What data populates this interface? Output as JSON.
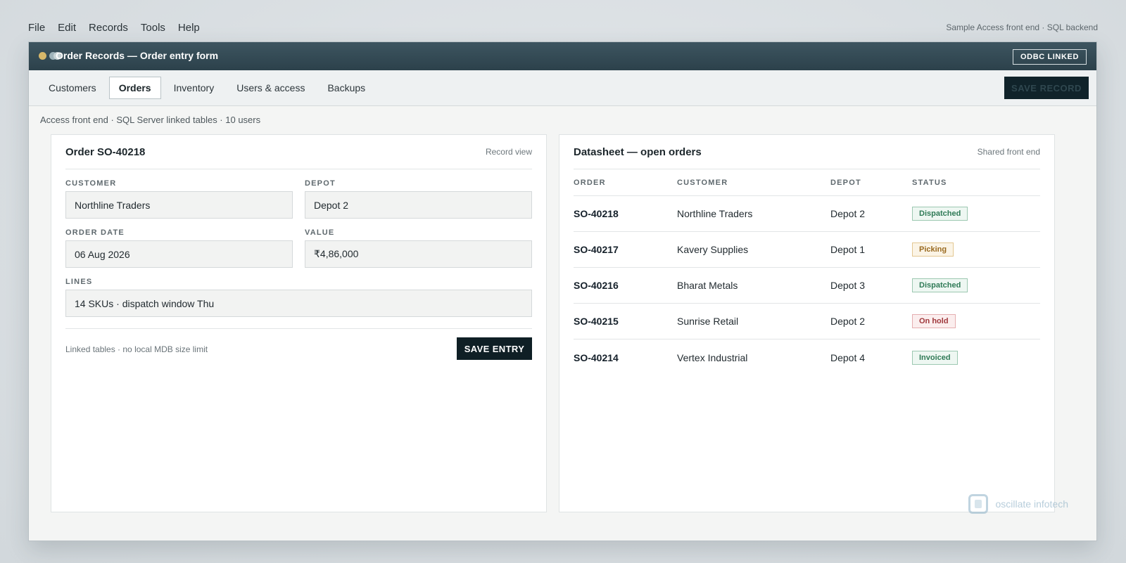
{
  "menu": {
    "items": [
      "File",
      "Edit",
      "Records",
      "Tools",
      "Help"
    ],
    "right_note": "Sample Access front end · SQL backend"
  },
  "window": {
    "title": "Order Records — Order entry form",
    "badge": "ODBC LINKED"
  },
  "tabs": [
    {
      "label": "Customers",
      "active": false
    },
    {
      "label": "Orders",
      "active": true
    },
    {
      "label": "Inventory",
      "active": false
    },
    {
      "label": "Users & access",
      "active": false
    },
    {
      "label": "Backups",
      "active": false
    }
  ],
  "toolbar": {
    "save_record_label": "SAVE RECORD"
  },
  "status_line": "Access front end · SQL Server linked tables · 10 users",
  "form": {
    "title": "Order SO-40218",
    "note": "Record view",
    "customer_label": "CUSTOMER",
    "customer_value": "Northline Traders",
    "depot_label": "DEPOT",
    "depot_value": "Depot 2",
    "order_date_label": "ORDER DATE",
    "order_date_value": "06 Aug 2026",
    "value_label": "VALUE",
    "value_value": "₹4,86,000",
    "lines_label": "LINES",
    "lines_value": "14 SKUs · dispatch window Thu",
    "footnote": "Linked tables · no local MDB size limit",
    "save_entry_label": "SAVE ENTRY"
  },
  "datasheet": {
    "title": "Datasheet — open orders",
    "note": "Shared front end",
    "columns": [
      "ORDER",
      "CUSTOMER",
      "DEPOT",
      "STATUS"
    ],
    "rows": [
      {
        "order": "SO-40218",
        "customer": "Northline Traders",
        "depot": "Depot 2",
        "status": "Dispatched",
        "status_type": "dispatched"
      },
      {
        "order": "SO-40217",
        "customer": "Kavery Supplies",
        "depot": "Depot 1",
        "status": "Picking",
        "status_type": "picking"
      },
      {
        "order": "SO-40216",
        "customer": "Bharat Metals",
        "depot": "Depot 3",
        "status": "Dispatched",
        "status_type": "dispatched"
      },
      {
        "order": "SO-40215",
        "customer": "Sunrise Retail",
        "depot": "Depot 2",
        "status": "On hold",
        "status_type": "hold"
      },
      {
        "order": "SO-40214",
        "customer": "Vertex Industrial",
        "depot": "Depot 4",
        "status": "Invoiced",
        "status_type": "invoiced"
      }
    ]
  },
  "watermark": {
    "text": "oscillate infotech"
  },
  "colors": {
    "titlebar": "#2c414b",
    "primary_button": "#0f1f25",
    "status_green": "#2f7a56",
    "status_amber": "#9a6a1f",
    "status_red": "#a0383c"
  }
}
